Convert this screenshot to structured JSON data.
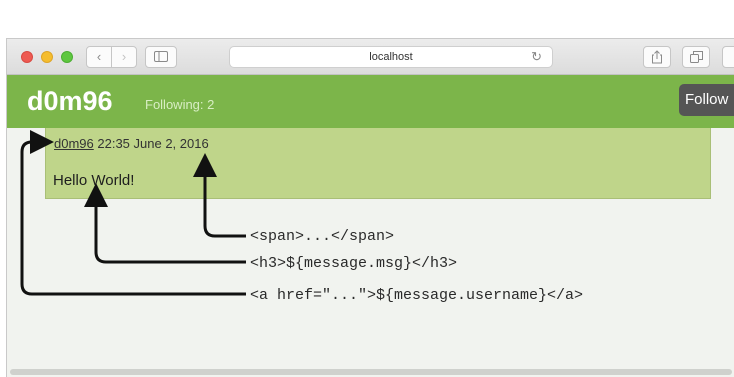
{
  "browser": {
    "address": "localhost",
    "back_icon": "‹",
    "forward_icon": "›",
    "reload_icon": "↻"
  },
  "app": {
    "brand": "d0m96",
    "following": "Following: 2",
    "follow_button": "Follow",
    "accent_color": "#7cb54a"
  },
  "message": {
    "username": "d0m96",
    "timestamp": "22:35 June 2, 2016",
    "text": "Hello World!"
  },
  "annotations": {
    "span_label": "<span>...</span>",
    "h3_label": "<h3>${message.msg}</h3>",
    "a_label": "<a href=\"...\">${message.username}</a>"
  }
}
